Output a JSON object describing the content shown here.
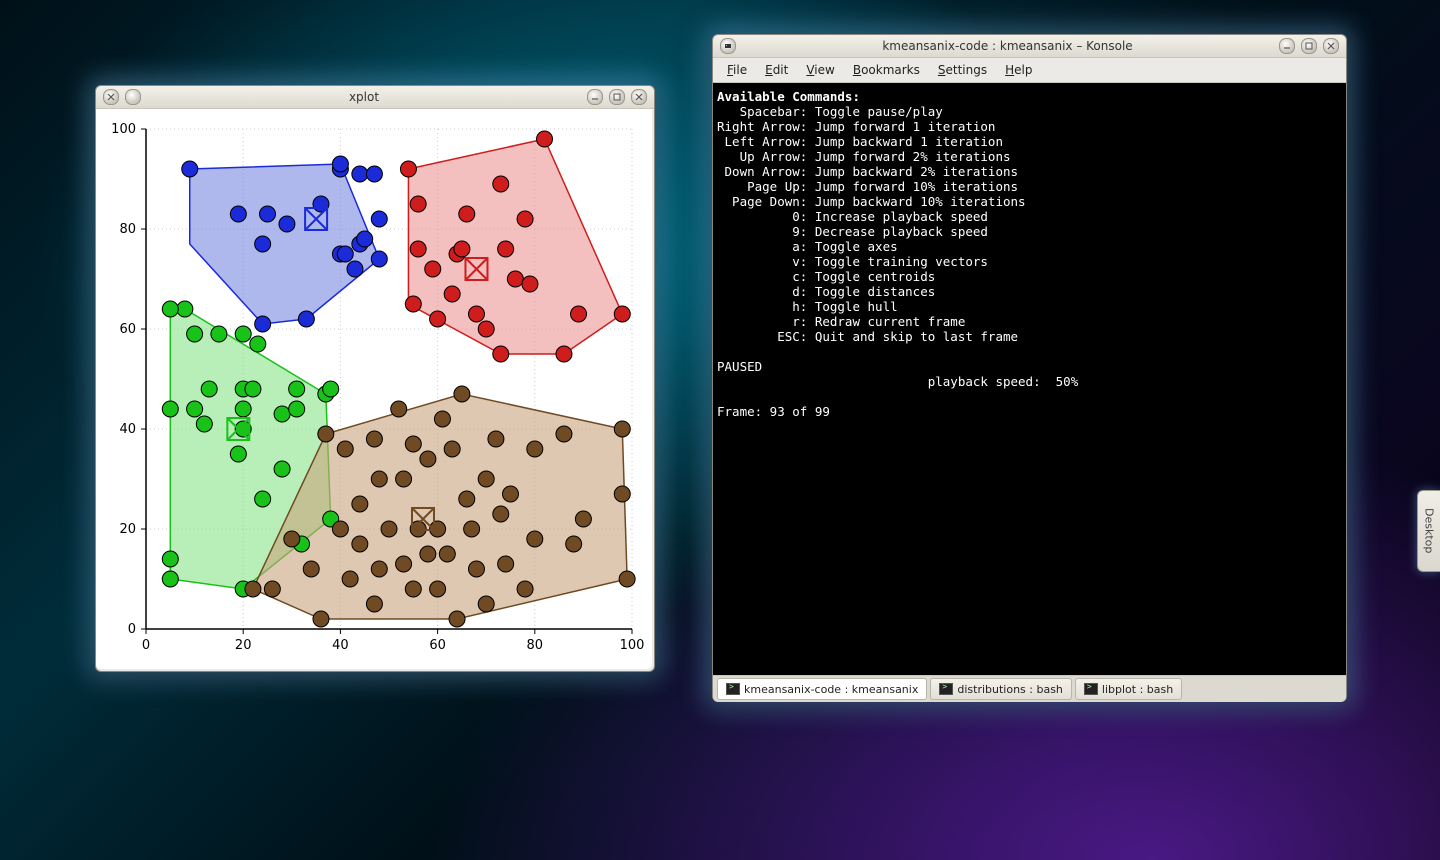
{
  "desktop": {
    "side_tab": "Desktop"
  },
  "xplot": {
    "title": "xplot"
  },
  "konsole": {
    "title": "kmeansanix-code : kmeansanix – Konsole",
    "menus": {
      "file": "File",
      "edit": "Edit",
      "view": "View",
      "bookmarks": "Bookmarks",
      "settings": "Settings",
      "help": "Help"
    },
    "tabs": [
      {
        "label": "kmeansanix-code : kmeansanix",
        "active": true
      },
      {
        "label": "distributions : bash",
        "active": false
      },
      {
        "label": "libplot : bash",
        "active": false
      }
    ],
    "term": {
      "header": "Available Commands:",
      "lines": [
        "   Spacebar: Toggle pause/play",
        "Right Arrow: Jump forward 1 iteration",
        " Left Arrow: Jump backward 1 iteration",
        "   Up Arrow: Jump forward 2% iterations",
        " Down Arrow: Jump backward 2% iterations",
        "    Page Up: Jump forward 10% iterations",
        "  Page Down: Jump backward 10% iterations",
        "          0: Increase playback speed",
        "          9: Decrease playback speed",
        "          a: Toggle axes",
        "          v: Toggle training vectors",
        "          c: Toggle centroids",
        "          d: Toggle distances",
        "          h: Toggle hull",
        "          r: Redraw current frame",
        "        ESC: Quit and skip to last frame"
      ],
      "status1": "PAUSED",
      "status2": "                            playback speed:  50%",
      "status3": "Frame: 93 of 99"
    }
  },
  "chart_data": {
    "type": "scatter",
    "title": "",
    "xlabel": "",
    "ylabel": "",
    "xlim": [
      0,
      100
    ],
    "ylim": [
      0,
      100
    ],
    "xticks": [
      0,
      20,
      40,
      60,
      80,
      100
    ],
    "yticks": [
      0,
      20,
      40,
      60,
      80,
      100
    ],
    "grid": true,
    "clusters": [
      {
        "name": "blue",
        "fill": "#6b7ede",
        "fill_opacity": 0.55,
        "stroke": "#1b2bd8",
        "point_fill": "#1b2bd8",
        "centroid": [
          35,
          82
        ],
        "hull": [
          [
            9,
            92
          ],
          [
            40,
            93
          ],
          [
            48,
            74
          ],
          [
            33,
            62
          ],
          [
            24,
            61
          ],
          [
            9,
            77
          ]
        ],
        "points": [
          [
            9,
            92
          ],
          [
            19,
            83
          ],
          [
            25,
            83
          ],
          [
            24,
            77
          ],
          [
            29,
            81
          ],
          [
            33,
            62
          ],
          [
            24,
            61
          ],
          [
            40,
            75
          ],
          [
            41,
            75
          ],
          [
            36,
            85
          ],
          [
            40,
            92
          ],
          [
            40,
            93
          ],
          [
            44,
            91
          ],
          [
            47,
            91
          ],
          [
            48,
            82
          ],
          [
            44,
            77
          ],
          [
            45,
            78
          ],
          [
            43,
            72
          ],
          [
            48,
            74
          ]
        ]
      },
      {
        "name": "red",
        "fill": "#e98b8b",
        "fill_opacity": 0.55,
        "stroke": "#cf1d1d",
        "point_fill": "#cf1d1d",
        "centroid": [
          68,
          72
        ],
        "hull": [
          [
            54,
            92
          ],
          [
            82,
            98
          ],
          [
            98,
            63
          ],
          [
            86,
            55
          ],
          [
            73,
            55
          ],
          [
            54,
            65
          ]
        ],
        "points": [
          [
            54,
            92
          ],
          [
            56,
            85
          ],
          [
            56,
            76
          ],
          [
            59,
            72
          ],
          [
            55,
            65
          ],
          [
            60,
            62
          ],
          [
            63,
            67
          ],
          [
            64,
            75
          ],
          [
            65,
            76
          ],
          [
            66,
            83
          ],
          [
            68,
            63
          ],
          [
            70,
            60
          ],
          [
            73,
            89
          ],
          [
            74,
            76
          ],
          [
            73,
            55
          ],
          [
            76,
            70
          ],
          [
            82,
            98
          ],
          [
            78,
            82
          ],
          [
            86,
            55
          ],
          [
            89,
            63
          ],
          [
            98,
            63
          ],
          [
            79,
            69
          ]
        ]
      },
      {
        "name": "green",
        "fill": "#7de27d",
        "fill_opacity": 0.55,
        "stroke": "#18c218",
        "point_fill": "#18c218",
        "centroid": [
          19,
          40
        ],
        "hull": [
          [
            8,
            64
          ],
          [
            37,
            47
          ],
          [
            38,
            22
          ],
          [
            20,
            8
          ],
          [
            5,
            10
          ],
          [
            5,
            64
          ]
        ],
        "points": [
          [
            8,
            64
          ],
          [
            5,
            64
          ],
          [
            10,
            59
          ],
          [
            15,
            59
          ],
          [
            20,
            59
          ],
          [
            23,
            57
          ],
          [
            13,
            48
          ],
          [
            20,
            48
          ],
          [
            22,
            48
          ],
          [
            5,
            44
          ],
          [
            10,
            44
          ],
          [
            20,
            44
          ],
          [
            12,
            41
          ],
          [
            20,
            40
          ],
          [
            19,
            35
          ],
          [
            28,
            43
          ],
          [
            31,
            44
          ],
          [
            31,
            48
          ],
          [
            37,
            47
          ],
          [
            38,
            48
          ],
          [
            28,
            32
          ],
          [
            24,
            26
          ],
          [
            32,
            17
          ],
          [
            38,
            22
          ],
          [
            20,
            8
          ],
          [
            5,
            14
          ],
          [
            5,
            10
          ]
        ]
      },
      {
        "name": "brown",
        "fill": "#c9a37d",
        "fill_opacity": 0.6,
        "stroke": "#6f4a22",
        "point_fill": "#6f4a22",
        "centroid": [
          57,
          22
        ],
        "hull": [
          [
            37,
            39
          ],
          [
            65,
            47
          ],
          [
            98,
            40
          ],
          [
            99,
            10
          ],
          [
            64,
            2
          ],
          [
            36,
            2
          ],
          [
            22,
            8
          ]
        ],
        "points": [
          [
            37,
            39
          ],
          [
            41,
            36
          ],
          [
            47,
            38
          ],
          [
            52,
            44
          ],
          [
            55,
            37
          ],
          [
            61,
            42
          ],
          [
            58,
            34
          ],
          [
            63,
            36
          ],
          [
            65,
            47
          ],
          [
            70,
            30
          ],
          [
            72,
            38
          ],
          [
            75,
            27
          ],
          [
            80,
            36
          ],
          [
            86,
            39
          ],
          [
            98,
            40
          ],
          [
            98,
            27
          ],
          [
            99,
            10
          ],
          [
            90,
            22
          ],
          [
            88,
            17
          ],
          [
            80,
            18
          ],
          [
            78,
            8
          ],
          [
            74,
            13
          ],
          [
            70,
            5
          ],
          [
            68,
            12
          ],
          [
            64,
            2
          ],
          [
            60,
            8
          ],
          [
            58,
            15
          ],
          [
            55,
            8
          ],
          [
            53,
            13
          ],
          [
            50,
            20
          ],
          [
            48,
            12
          ],
          [
            44,
            17
          ],
          [
            42,
            10
          ],
          [
            40,
            20
          ],
          [
            36,
            2
          ],
          [
            34,
            12
          ],
          [
            30,
            18
          ],
          [
            26,
            8
          ],
          [
            22,
            8
          ],
          [
            44,
            25
          ],
          [
            48,
            30
          ],
          [
            53,
            30
          ],
          [
            56,
            20
          ],
          [
            60,
            20
          ],
          [
            62,
            15
          ],
          [
            67,
            20
          ],
          [
            73,
            23
          ],
          [
            66,
            26
          ],
          [
            47,
            5
          ]
        ]
      }
    ]
  }
}
